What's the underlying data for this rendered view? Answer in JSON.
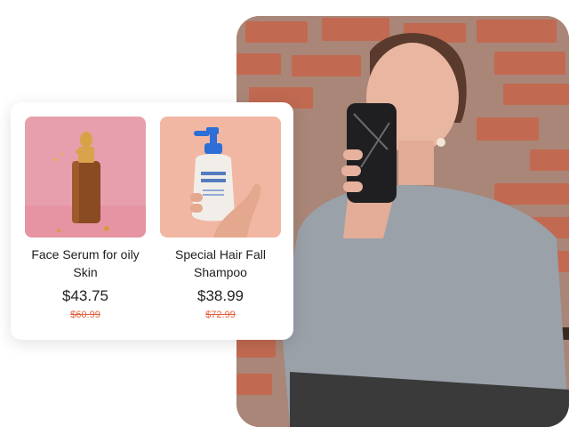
{
  "products": [
    {
      "name": "Face Serum for oily Skin",
      "price": "$43.75",
      "original_price": "$60.99",
      "image_icon": "serum-dropper-bottle-icon"
    },
    {
      "name": "Special Hair Fall Shampoo",
      "price": "$38.99",
      "original_price": "$72.99",
      "image_icon": "cream-pump-bottle-icon",
      "bottle_label": "CREAM BOTTLE"
    }
  ],
  "colors": {
    "sale_price": "#e0603f",
    "serum_background": "#e89fad",
    "shampoo_background": "#f2b7a3",
    "brick_wall": "#b9856f"
  }
}
